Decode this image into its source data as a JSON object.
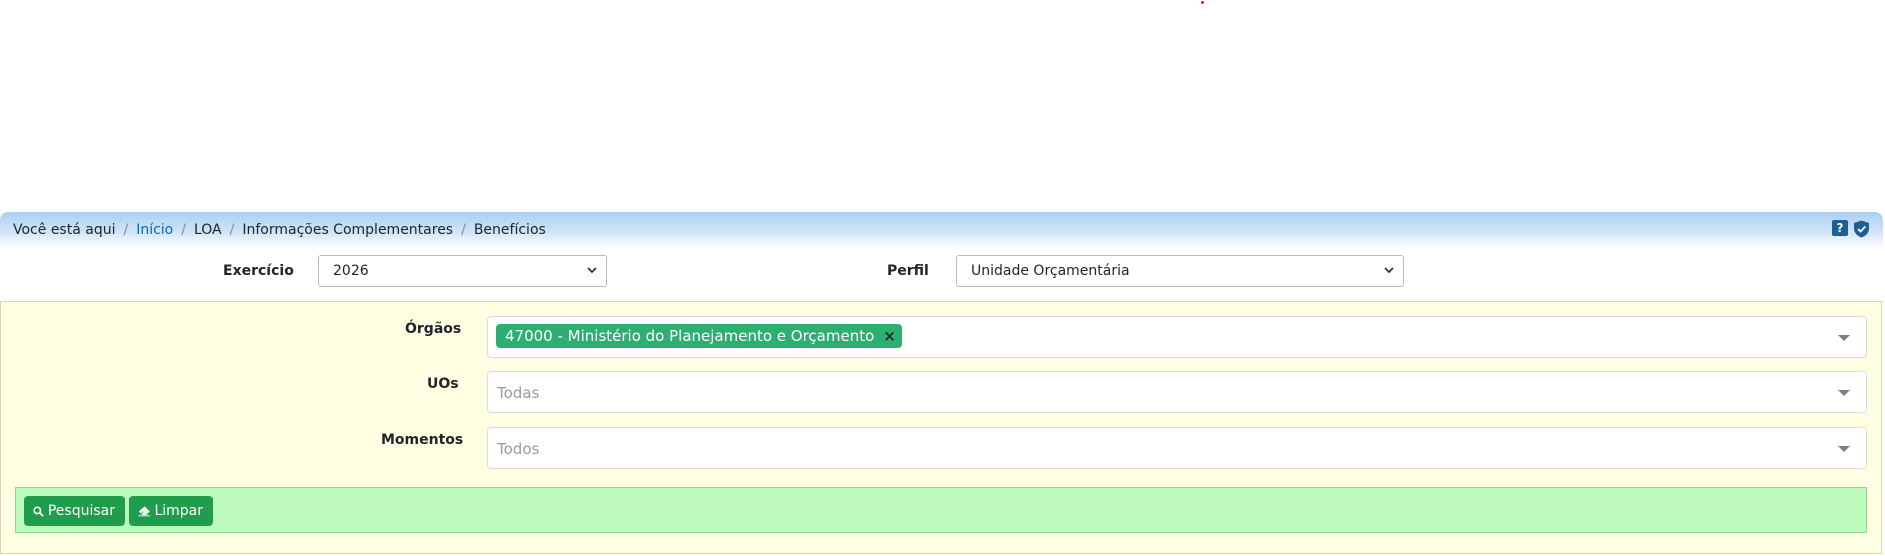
{
  "breadcrumb": {
    "prefix": "Você está aqui",
    "items": [
      "Início",
      "LOA",
      "Informações Complementares",
      "Benefícios"
    ]
  },
  "header_icons": {
    "help": "?",
    "help_icon": "question-icon",
    "shield_icon": "shield-check-icon"
  },
  "filters": {
    "exercicio": {
      "label": "Exercício",
      "value": "2026"
    },
    "perfil": {
      "label": "Perfil",
      "value": "Unidade Orçamentária"
    }
  },
  "panel": {
    "orgaos": {
      "label": "Órgãos",
      "tag": "47000 - Ministério do Planejamento e Orçamento",
      "remove": "×"
    },
    "uos": {
      "label": "UOs",
      "placeholder": "Todas"
    },
    "momentos": {
      "label": "Momentos",
      "placeholder": "Todos"
    }
  },
  "actions": {
    "search_label": "Pesquisar",
    "clear_label": "Limpar"
  },
  "colors": {
    "accent_green": "#1f9d4c",
    "tag_green": "#2fae72",
    "link_blue": "#0b6ca8",
    "panel_bg": "#fefee3",
    "action_bar_bg": "#bdfbbd"
  }
}
